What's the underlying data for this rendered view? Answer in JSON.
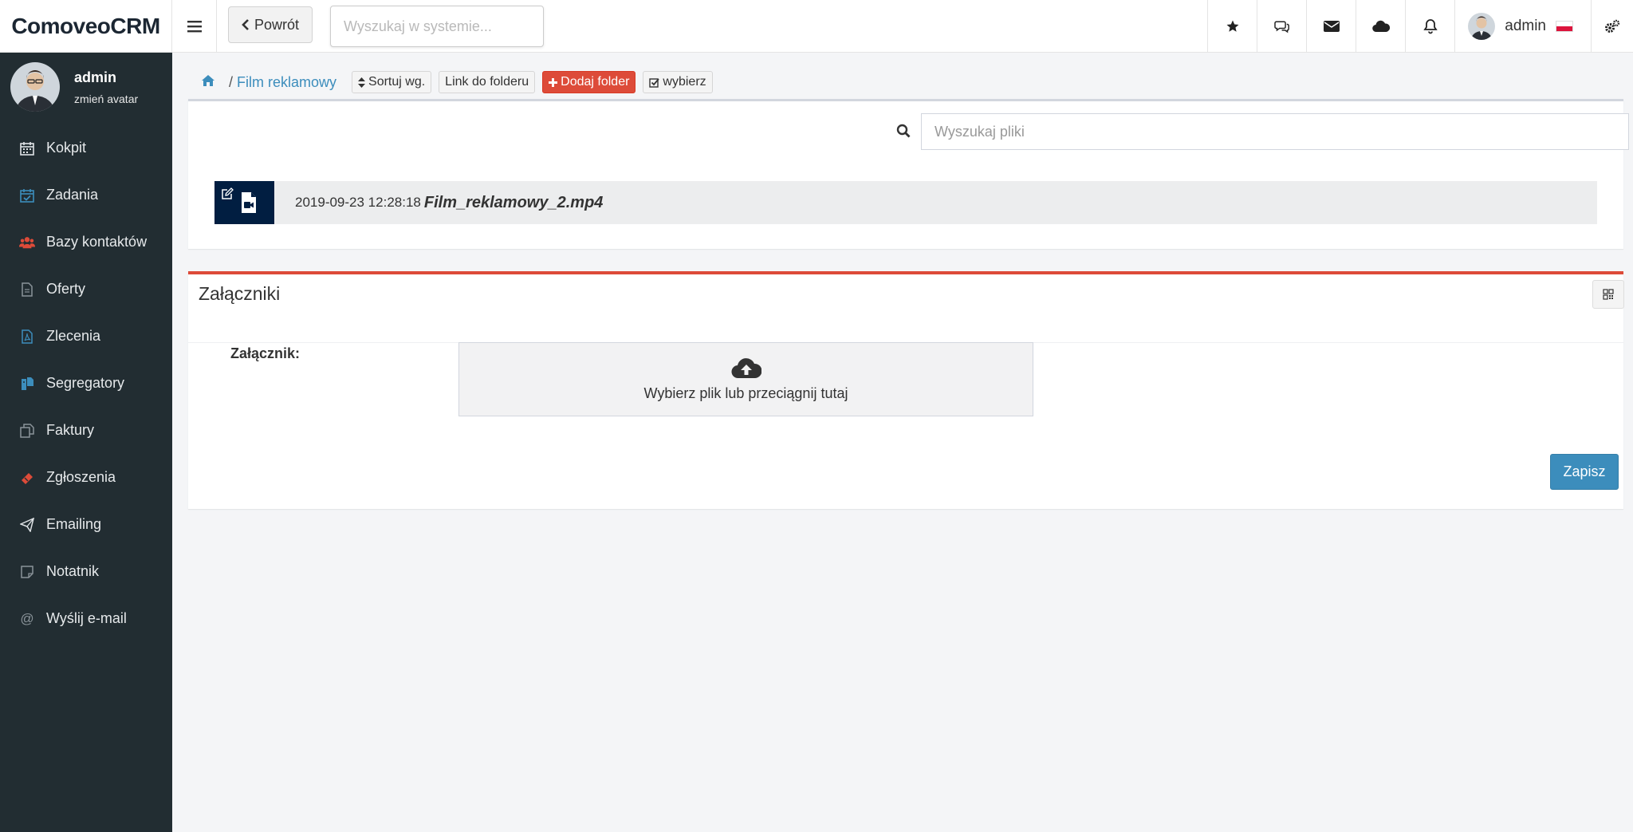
{
  "app": {
    "brand": "ComoveoCRM"
  },
  "topbar": {
    "back_label": "Powrót",
    "search_placeholder": "Wyszukaj w systemie...",
    "user_name": "admin"
  },
  "sidebar": {
    "user": {
      "name": "admin",
      "change_avatar": "zmień avatar"
    },
    "items": [
      {
        "label": "Kokpit",
        "icon": "calendar-icon",
        "color": "#dfe3e6"
      },
      {
        "label": "Zadania",
        "icon": "calendar-check-icon",
        "color": "#3c8dbc"
      },
      {
        "label": "Bazy kontaktów",
        "icon": "users-icon",
        "color": "#dd4b39"
      },
      {
        "label": "Oferty",
        "icon": "document-icon",
        "color": "#8a9399"
      },
      {
        "label": "Zlecenia",
        "icon": "pdf-file-icon",
        "color": "#3c8dbc"
      },
      {
        "label": "Segregatory",
        "icon": "binder-icon",
        "color": "#3c8dbc"
      },
      {
        "label": "Faktury",
        "icon": "copy-icon",
        "color": "#8a9399"
      },
      {
        "label": "Zgłoszenia",
        "icon": "ticket-icon",
        "color": "#dd4b39"
      },
      {
        "label": "Emailing",
        "icon": "paper-plane-icon",
        "color": "#dfe3e6"
      },
      {
        "label": "Notatnik",
        "icon": "note-icon",
        "color": "#8a9399"
      },
      {
        "label": "Wyślij e-mail",
        "icon": "at-icon",
        "color": "#8a9399"
      }
    ]
  },
  "breadcrumb": {
    "folder": "Film reklamowy",
    "sort_label": "Sortuj wg.",
    "link_label": "Link do folderu",
    "add_folder_label": "Dodaj folder",
    "select_label": "wybierz"
  },
  "files": {
    "search_placeholder": "Wyszukaj pliki",
    "items": [
      {
        "date": "2019-09-23 12:28:18",
        "name": "Film_reklamowy_2.mp4"
      }
    ]
  },
  "attachments": {
    "title": "Załączniki",
    "field_label": "Załącznik:",
    "dropzone_text": "Wybierz plik  lub  przeciągnij tutaj",
    "save_label": "Zapisz"
  },
  "colors": {
    "sidebar_bg": "#222d32",
    "primary": "#3c8dbc",
    "danger": "#dd4b39",
    "file_icon_bg": "#011e41"
  }
}
